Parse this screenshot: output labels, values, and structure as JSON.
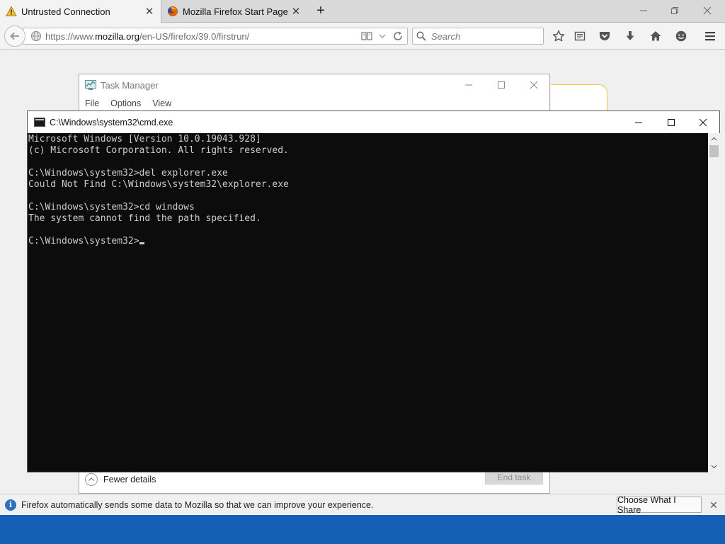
{
  "browser": {
    "tabs": [
      {
        "label": "Untrusted Connection",
        "icon": "warning-icon",
        "active": true
      },
      {
        "label": "Mozilla Firefox Start Page",
        "icon": "firefox-icon",
        "active": false
      }
    ],
    "url": {
      "prefix": "https://www.",
      "domain": "mozilla.org",
      "path": "/en-US/firefox/39.0/firstrun/"
    },
    "search_placeholder": "Search",
    "toolbar_icons": [
      "bookmark-star-icon",
      "reading-list-icon",
      "pocket-icon",
      "download-icon",
      "home-icon",
      "hello-icon",
      "menu-icon"
    ]
  },
  "task_manager": {
    "title": "Task Manager",
    "menu": [
      "File",
      "Options",
      "View"
    ],
    "fewer_details": "Fewer details",
    "end_task": "End task"
  },
  "cmd": {
    "title": "C:\\Windows\\system32\\cmd.exe",
    "lines": [
      "Microsoft Windows [Version 10.0.19043.928]",
      "(c) Microsoft Corporation. All rights reserved.",
      "",
      "C:\\Windows\\system32>del explorer.exe",
      "Could Not Find C:\\Windows\\system32\\explorer.exe",
      "",
      "C:\\Windows\\system32>cd windows",
      "The system cannot find the path specified.",
      ""
    ],
    "prompt": "C:\\Windows\\system32>"
  },
  "notification": {
    "text": "Firefox automatically sends some data to Mozilla so that we can improve your experience.",
    "button": "Choose What I Share"
  },
  "colors": {
    "taskbar": "#1460b4",
    "console_bg": "#0c0c0c",
    "console_fg": "#cccccc",
    "info_blue": "#2e6fbe"
  }
}
